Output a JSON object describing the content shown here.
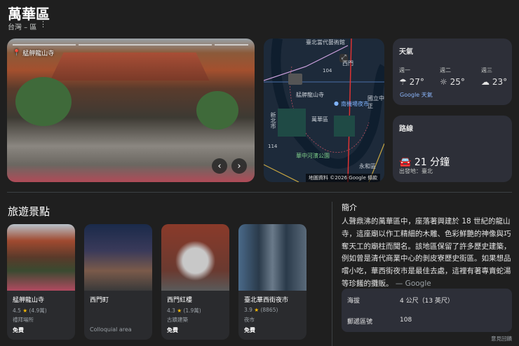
{
  "header": {
    "title": "萬華區",
    "subtitle": "台灣 – 區",
    "more_icon": "more-vert-icon"
  },
  "photo": {
    "location_label": "艋舺龍山寺",
    "prev_icon": "chevron-left-icon",
    "next_icon": "chevron-right-icon"
  },
  "map": {
    "labels": [
      "臺北當代藝術館",
      "西門",
      "艋舺龍山寺",
      "南機場夜市",
      "萬華區",
      "華中河濱公園",
      "永和區",
      "國立中正",
      "新北市",
      "104",
      "114"
    ],
    "attribution": "地圖資料 ©2026 Google",
    "terms": "條款"
  },
  "weather": {
    "title": "天氣",
    "days": [
      {
        "day": "週一",
        "temp": "27°",
        "icon": "rain-icon"
      },
      {
        "day": "週二",
        "temp": "25°",
        "icon": "partly-sunny-icon"
      },
      {
        "day": "週三",
        "temp": "23°",
        "icon": "cloud-icon"
      }
    ],
    "source": "Google 天氣"
  },
  "route": {
    "title": "路線",
    "time": "21 分鐘",
    "from": "出發地：臺北"
  },
  "attractions": {
    "title": "旅遊景點",
    "items": [
      {
        "name": "艋舺龍山寺",
        "rating": "4.5",
        "reviews": "(4.9萬)",
        "type": "禮拜場所",
        "fee": "免費"
      },
      {
        "name": "西門町",
        "note": "Colloquial area"
      },
      {
        "name": "西門紅樓",
        "rating": "4.3",
        "reviews": "(1.9萬)",
        "type": "古蹟建築",
        "fee": "免費"
      },
      {
        "name": "臺北華西街夜市",
        "rating": "3.9",
        "reviews": "(8865)",
        "type": "夜市",
        "fee": "免費"
      }
    ]
  },
  "intro": {
    "title": "簡介",
    "text": "人聲鼎沸的萬華區中，座落著興建於 18 世紀的龍山寺，這座廟以作工精細的木雕、色彩鮮艷的神像與巧奪天工的廟柱而聞名。該地區保留了許多歷史建築，例如曾是清代商業中心的剝皮寮歷史街區。如果想品嚐小吃，華西街夜市是最佳去處，這裡有著專賣蛇湯等珍饈的攤販。",
    "source": "— Google"
  },
  "facts": [
    {
      "label": "海拔",
      "value": "4 公尺（13 英尺）"
    },
    {
      "label": "郵遞區號",
      "value": "108"
    }
  ],
  "feedback": "意見回饋"
}
